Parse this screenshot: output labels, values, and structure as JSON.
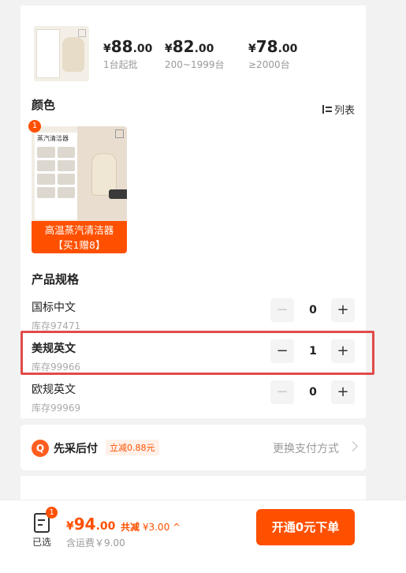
{
  "tiers": [
    {
      "currency": "¥",
      "int": "88",
      "dec": ".00",
      "cond": "1台起批"
    },
    {
      "currency": "¥",
      "int": "82",
      "dec": ".00",
      "cond": "200~1999台"
    },
    {
      "currency": "¥",
      "int": "78",
      "dec": ".00",
      "cond": "≥2000台"
    }
  ],
  "color": {
    "title": "颜色",
    "view_label": "列表",
    "option_badge": "1",
    "option_doc_title": "蒸汽清洁器",
    "option_label_line1": "高温蒸汽清洁器",
    "option_label_line2": "【买1赠8】"
  },
  "spec": {
    "title": "产品规格",
    "rows": [
      {
        "name": "国标中文",
        "stock": "库存97471",
        "qty": "0",
        "minus": "−",
        "plus": "+"
      },
      {
        "name": "美规英文",
        "stock": "库存99966",
        "qty": "1",
        "minus": "−",
        "plus": "+"
      },
      {
        "name": "欧规英文",
        "stock": "库存99969",
        "qty": "0",
        "minus": "−",
        "plus": "+"
      }
    ]
  },
  "pay_later": {
    "icon": "Q",
    "title": "先采后付",
    "tag": "立减0.88元",
    "change": "更换支付方式"
  },
  "bottom": {
    "cart_badge": "1",
    "cart_label": "已选",
    "total_currency": "¥",
    "total_int": "94",
    "total_dec": ".00",
    "discount_key": "共减",
    "discount_value": "¥3.00",
    "discount_caret": "^",
    "shipping": "含运费￥9.00",
    "submit": "开通0元下单"
  },
  "colors": {
    "accent": "#ff5000",
    "highlight": "#e04b4b"
  }
}
